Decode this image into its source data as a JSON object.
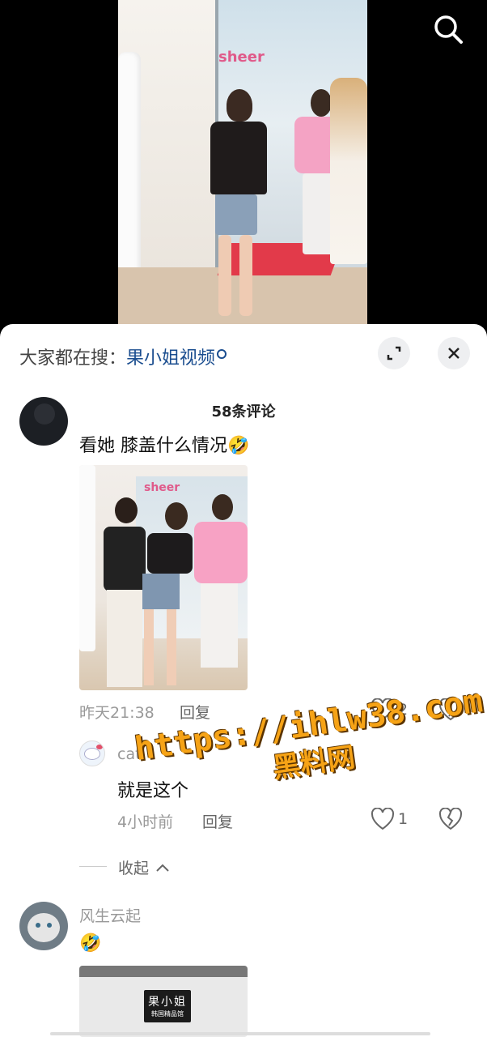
{
  "search_hint": {
    "prefix": "大家都在搜：",
    "keyword": "果小姐视频"
  },
  "comments_count_label": "58条评论",
  "comments": [
    {
      "text": "看她 膝盖什么情况",
      "emoji": "🤣",
      "time": "昨天21:38",
      "reply_label": "回复",
      "likes": "2",
      "replies": [
        {
          "user": "cat",
          "text": "就是这个",
          "time": "4小时前",
          "reply_label": "回复",
          "likes": "1"
        }
      ],
      "collapse_label": "收起"
    },
    {
      "user": "风生云起",
      "emoji": "🤣",
      "photo_sign": "果小姐",
      "photo_sign_sub": "韩国精品馆"
    }
  ],
  "watermark": {
    "line1": "https://ihlw38.com",
    "line2": "黑料网"
  },
  "video_sign": "sheer",
  "photo1_sign": "sheer"
}
